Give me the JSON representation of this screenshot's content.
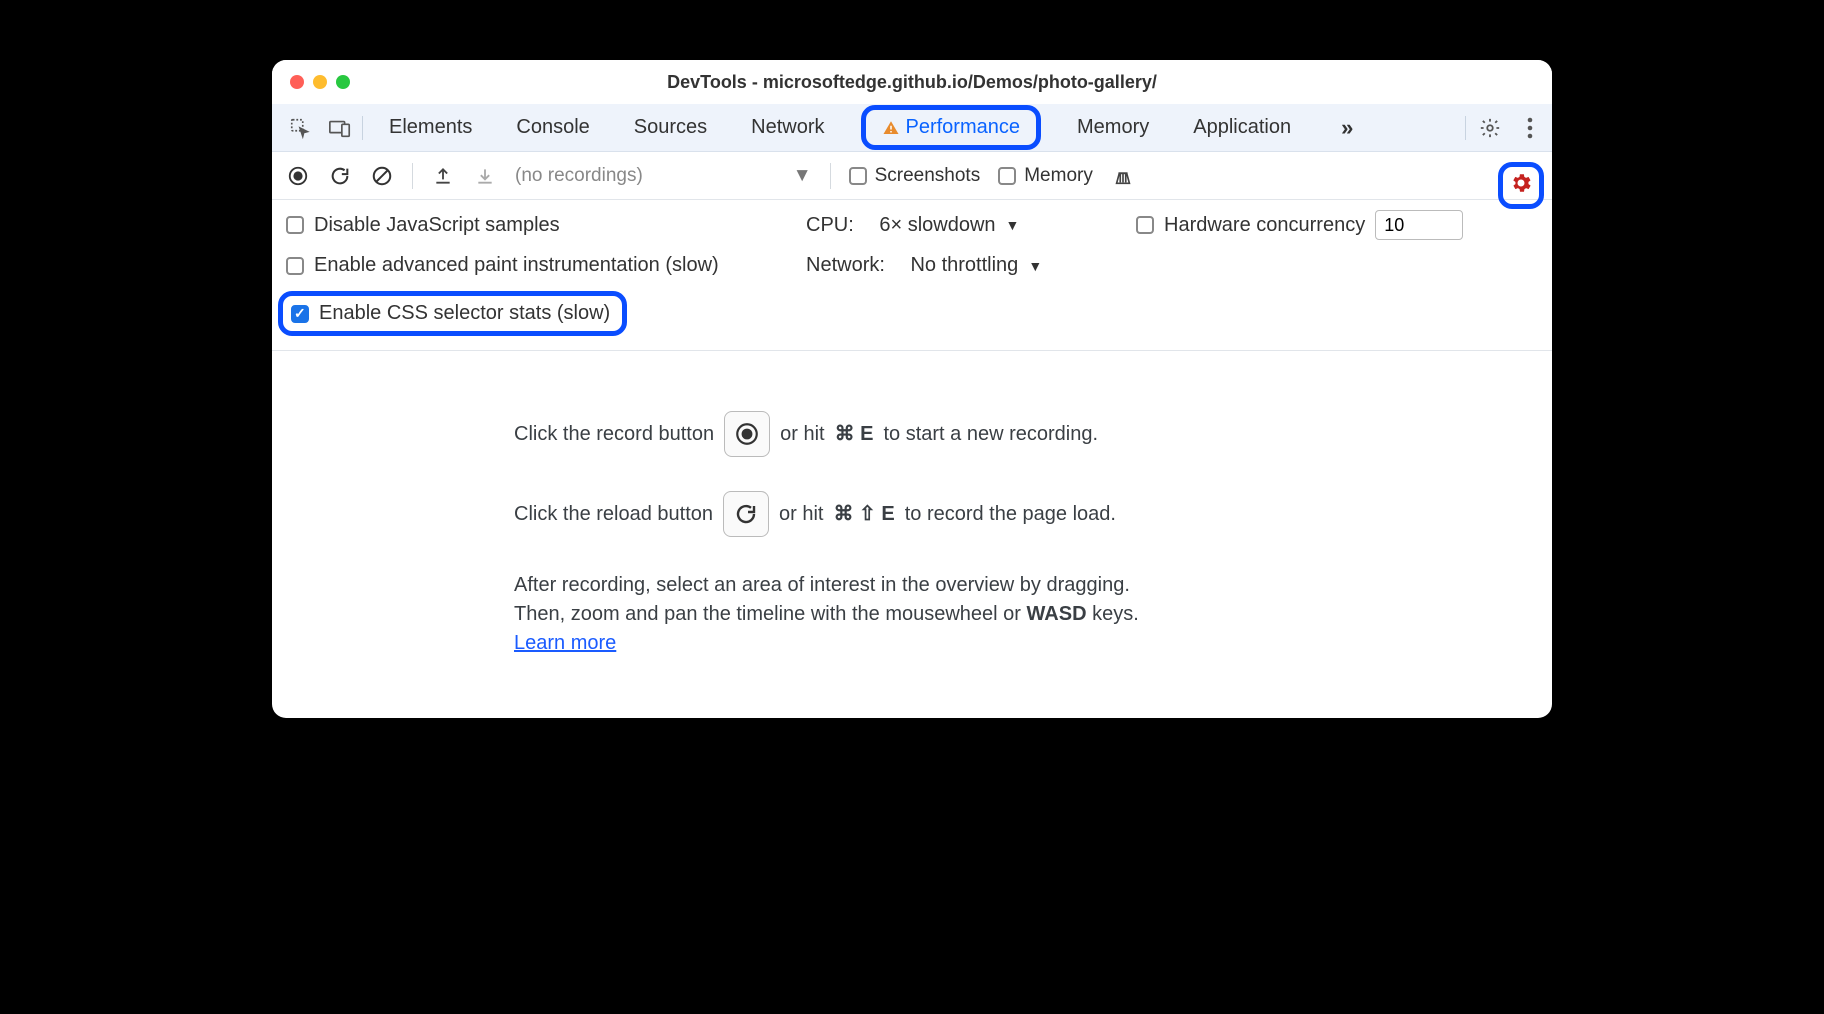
{
  "window": {
    "title": "DevTools - microsoftedge.github.io/Demos/photo-gallery/"
  },
  "tabs": {
    "items": [
      "Elements",
      "Console",
      "Sources",
      "Network",
      "Performance",
      "Memory",
      "Application"
    ],
    "active": "Performance",
    "more_glyph": "»"
  },
  "toolbar": {
    "recordings_placeholder": "(no recordings)",
    "screenshots_label": "Screenshots",
    "memory_label": "Memory"
  },
  "options": {
    "disable_js_samples": {
      "label": "Disable JavaScript samples",
      "checked": false
    },
    "cpu_label": "CPU:",
    "cpu_value": "6× slowdown",
    "hw_concurrency": {
      "label": "Hardware concurrency",
      "checked": false,
      "value": "10"
    },
    "advanced_paint": {
      "label": "Enable advanced paint instrumentation (slow)",
      "checked": false
    },
    "network_label": "Network:",
    "network_value": "No throttling",
    "css_stats": {
      "label": "Enable CSS selector stats (slow)",
      "checked": true
    }
  },
  "instructions": {
    "record_pre": "Click the record button",
    "record_post_a": "or hit",
    "record_key": "⌘ E",
    "record_post_b": "to start a new recording.",
    "reload_pre": "Click the reload button",
    "reload_post_a": "or hit",
    "reload_key": "⌘ ⇧ E",
    "reload_post_b": "to record the page load.",
    "after_a": "After recording, select an area of interest in the overview by dragging.",
    "after_b_pre": "Then, zoom and pan the timeline with the mousewheel or ",
    "after_b_key": "WASD",
    "after_b_post": " keys.",
    "learn_more": "Learn more"
  }
}
